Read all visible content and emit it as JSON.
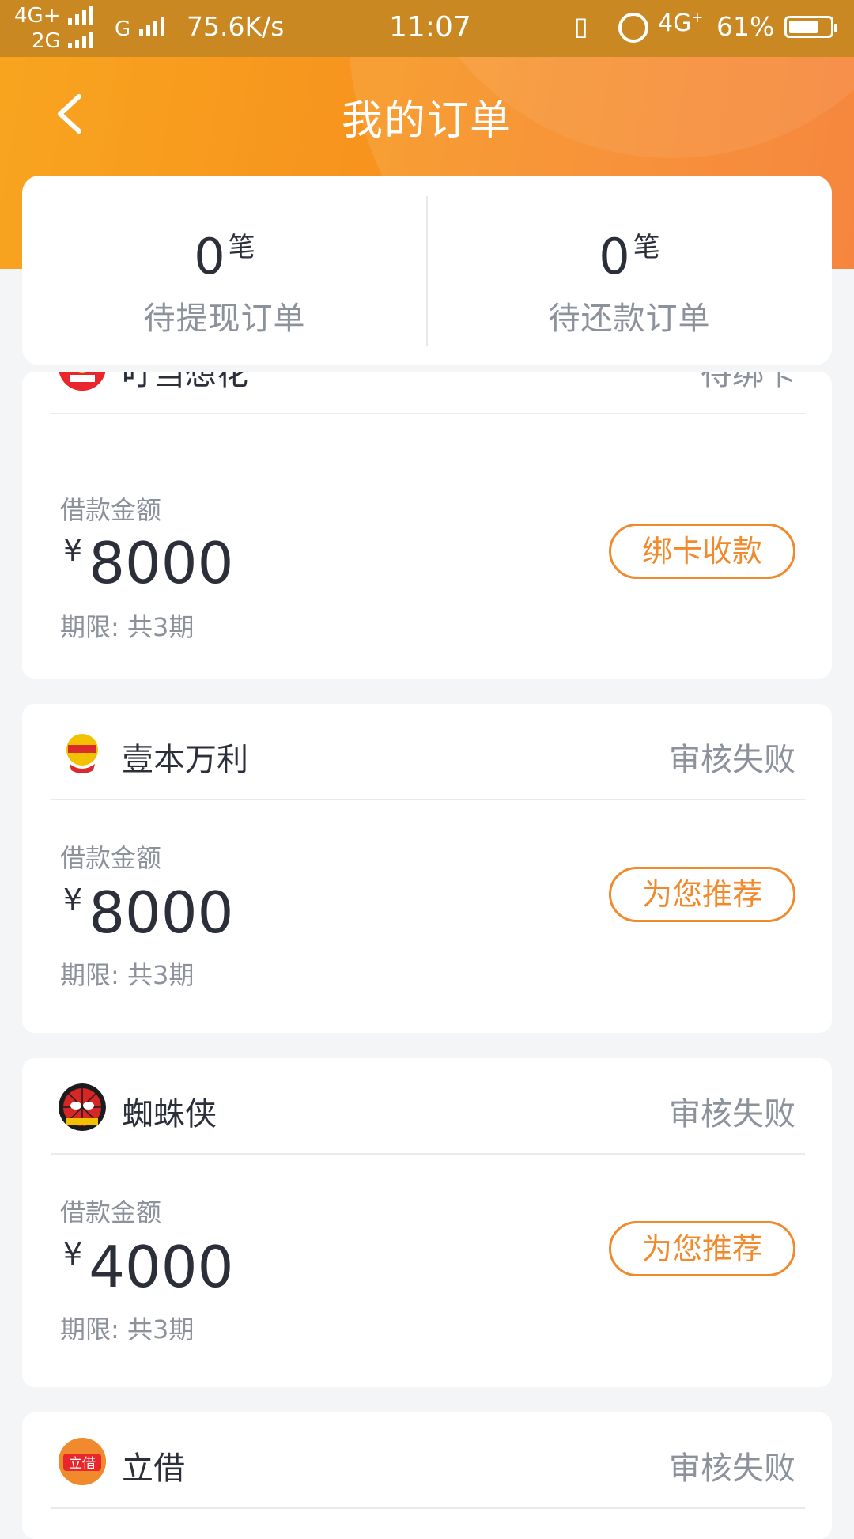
{
  "status_bar": {
    "network_primary": "4G+",
    "network_secondary": "2G",
    "network_g": "G",
    "speed": "75.6K/s",
    "time": "11:07",
    "network_right": "4G",
    "battery_pct": "61%",
    "battery_level": 0.61
  },
  "header": {
    "title": "我的订单",
    "back_icon": "chevron-left-icon"
  },
  "summary": {
    "pending_withdraw": {
      "count": "0",
      "unit": "笔",
      "label": "待提现订单"
    },
    "pending_repay": {
      "count": "0",
      "unit": "笔",
      "label": "待还款订单"
    }
  },
  "orders": [
    {
      "name": "叮当想花",
      "status": "待绑卡",
      "amount_label": "借款金额",
      "currency": "¥",
      "amount": "8000",
      "term": "期限: 共3期",
      "action": "绑卡收款",
      "logo_color": "#e8262b"
    },
    {
      "name": "壹本万利",
      "status": "审核失败",
      "amount_label": "借款金额",
      "currency": "¥",
      "amount": "8000",
      "term": "期限: 共3期",
      "action": "为您推荐",
      "logo_color": "#f2c200"
    },
    {
      "name": "蜘蛛侠",
      "status": "审核失败",
      "amount_label": "借款金额",
      "currency": "¥",
      "amount": "4000",
      "term": "期限: 共3期",
      "action": "为您推荐",
      "logo_color": "#d62626"
    },
    {
      "name": "立借",
      "status": "审核失败",
      "logo_color": "#f08a2c",
      "logo_text": "立借"
    }
  ],
  "colors": {
    "accent": "#f08a2c",
    "header_start": "#f8a51f",
    "header_end": "#f5792a"
  }
}
